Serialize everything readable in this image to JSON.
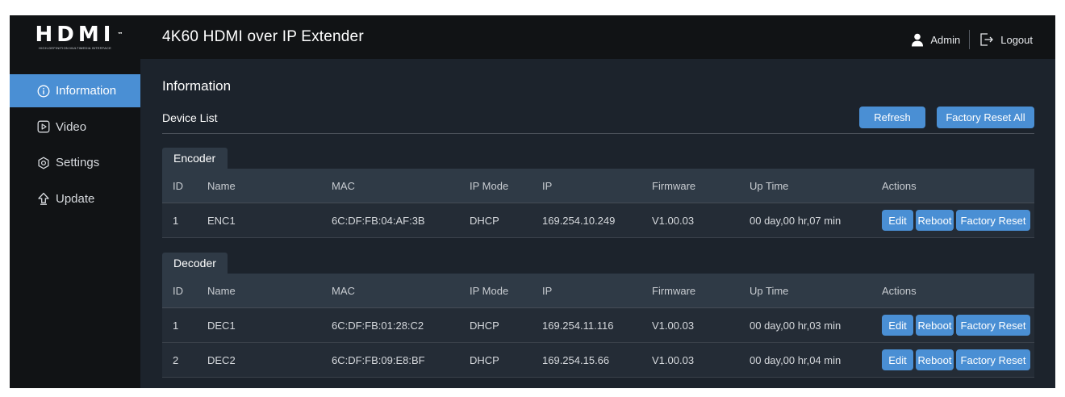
{
  "brand": {
    "logo_text": "HDMI",
    "logo_tm": "™",
    "logo_sub": "HIGH-DEFINITION MULTIMEDIA INTERFACE"
  },
  "header": {
    "title": "4K60 HDMI over IP Extender",
    "user": "Admin",
    "logout": "Logout"
  },
  "sidebar": {
    "items": [
      {
        "label": "Information",
        "icon": "info-icon",
        "active": true
      },
      {
        "label": "Video",
        "icon": "play-icon",
        "active": false
      },
      {
        "label": "Settings",
        "icon": "gear-icon",
        "active": false
      },
      {
        "label": "Update",
        "icon": "upload-arrow-icon",
        "active": false
      }
    ]
  },
  "main": {
    "title": "Information",
    "device_list_label": "Device List",
    "refresh_label": "Refresh",
    "factory_reset_all_label": "Factory Reset All",
    "columns": [
      "ID",
      "Name",
      "MAC",
      "IP Mode",
      "IP",
      "Firmware",
      "Up Time",
      "Actions"
    ],
    "actions": {
      "edit": "Edit",
      "reboot": "Reboot",
      "reset": "Factory Reset"
    },
    "encoder": {
      "tab": "Encoder",
      "rows": [
        {
          "id": "1",
          "name": "ENC1",
          "mac": "6C:DF:FB:04:AF:3B",
          "mode": "DHCP",
          "ip": "169.254.10.249",
          "fw": "V1.00.03",
          "up": "00 day,00 hr,07 min"
        }
      ]
    },
    "decoder": {
      "tab": "Decoder",
      "rows": [
        {
          "id": "1",
          "name": "DEC1",
          "mac": "6C:DF:FB:01:28:C2",
          "mode": "DHCP",
          "ip": "169.254.11.116",
          "fw": "V1.00.03",
          "up": "00 day,00 hr,03 min"
        },
        {
          "id": "2",
          "name": "DEC2",
          "mac": "6C:DF:FB:09:E8:BF",
          "mode": "DHCP",
          "ip": "169.254.15.66",
          "fw": "V1.00.03",
          "up": "00 day,00 hr,04 min"
        }
      ]
    }
  },
  "colors": {
    "accent": "#4a8fd4",
    "sidebar_bg": "#111315",
    "panel_bg": "#1c232c",
    "header_row": "#2f3a46"
  }
}
